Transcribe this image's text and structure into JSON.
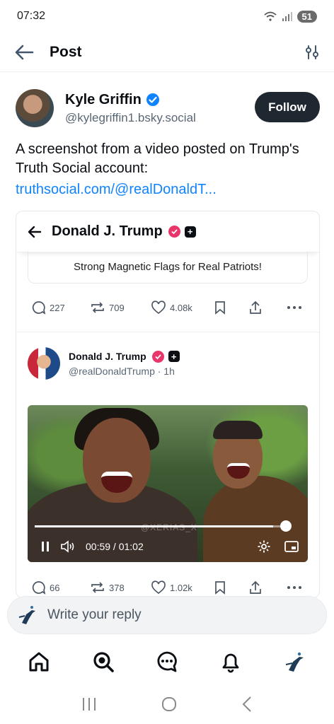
{
  "status_bar": {
    "time": "07:32",
    "battery": "51"
  },
  "header": {
    "title": "Post",
    "back_icon": "arrow-left-icon",
    "settings_icon": "sliders-icon"
  },
  "author": {
    "display_name": "Kyle Griffin",
    "handle": "@kylegriffin1.bsky.social",
    "follow_label": "Follow"
  },
  "post": {
    "text": "A screenshot from a video posted on Trump's Truth Social account:",
    "link": "truthsocial.com/@realDonaldT..."
  },
  "embed": {
    "profile_name": "Donald J. Trump",
    "flags_text": "Strong Magnetic Flags for Real Patriots!",
    "first_actions": {
      "replies": "227",
      "reposts": "709",
      "likes": "4.08k"
    },
    "inner_post": {
      "display_name": "Donald J. Trump",
      "handle": "@realDonaldTrump · 1h"
    },
    "video": {
      "current_time": "00:59",
      "total_time": "01:02",
      "time_label": "00:59 / 01:02",
      "watermark": "@XERIAS_X",
      "progress": 0.95
    },
    "second_actions": {
      "replies": "66",
      "reposts": "378",
      "likes": "1.02k"
    }
  },
  "reply_bar": {
    "placeholder": "Write your reply"
  },
  "colors": {
    "link": "#1083fe",
    "follow_bg": "#1f2730",
    "verified": "#1083fe"
  }
}
